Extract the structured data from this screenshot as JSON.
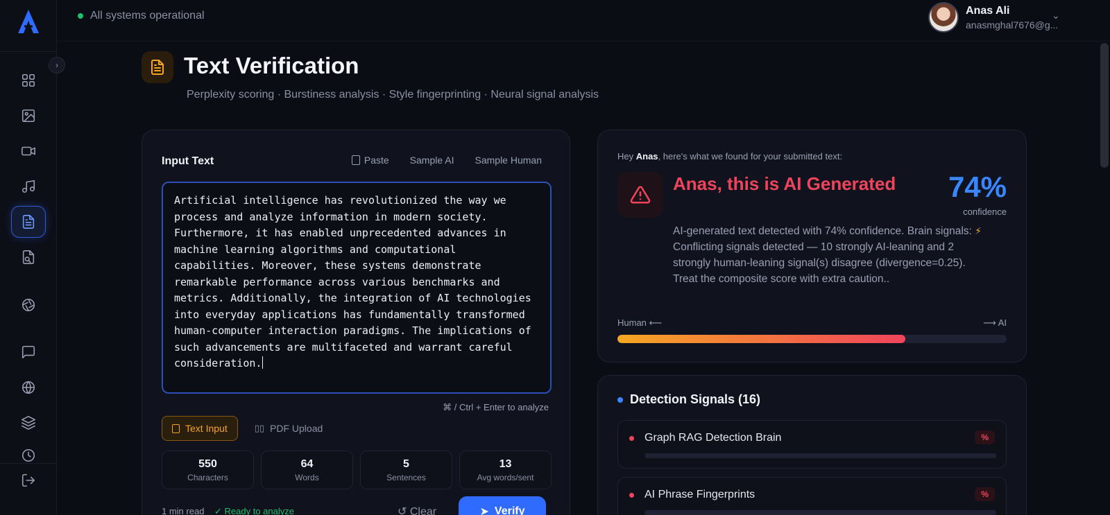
{
  "topbar": {
    "status": "All systems operational"
  },
  "user": {
    "name": "Anas Ali",
    "email": "anasmghal7676@g..."
  },
  "sidebar": {
    "items": [
      {
        "icon": "dashboard-icon"
      },
      {
        "icon": "image-icon"
      },
      {
        "icon": "video-icon"
      },
      {
        "icon": "music-icon"
      },
      {
        "icon": "document-icon",
        "active": true
      },
      {
        "icon": "file-search-icon"
      },
      {
        "icon": "aperture-icon"
      },
      {
        "icon": "chat-icon"
      },
      {
        "icon": "globe-icon"
      },
      {
        "icon": "layers-icon"
      },
      {
        "icon": "history-icon"
      },
      {
        "icon": "logout-icon"
      }
    ]
  },
  "header": {
    "title": "Text Verification",
    "subtitle": "Perplexity scoring · Burstiness analysis · Style fingerprinting · Neural signal analysis"
  },
  "input": {
    "label": "Input Text",
    "actions": {
      "paste": "Paste",
      "sample_ai": "Sample AI",
      "sample_human": "Sample Human"
    },
    "text": "Artificial intelligence has revolutionized the way we process and analyze information in modern society. Furthermore, it has enabled unprecedented advances in machine learning algorithms and computational capabilities. Moreover, these systems demonstrate remarkable performance across various benchmarks and metrics. Additionally, the integration of AI technologies into everyday applications has fundamentally transformed human-computer interaction paradigms. The implications of such advancements are multifaceted and warrant careful consideration.",
    "shortcut": "⌘ / Ctrl + Enter to analyze",
    "modes": {
      "text": "Text Input",
      "pdf": "PDF Upload"
    },
    "stats": [
      {
        "value": "550",
        "label": "Characters"
      },
      {
        "value": "64",
        "label": "Words"
      },
      {
        "value": "5",
        "label": "Sentences"
      },
      {
        "value": "13",
        "label": "Avg words/sent"
      }
    ],
    "read_time": "1 min read",
    "ready": "✓ Ready to analyze",
    "clear": "↺ Clear",
    "verify": "Verify"
  },
  "result": {
    "greet_prefix": "Hey",
    "greet_name": "Anas",
    "greet_suffix": ", here's what we found for your submitted text:",
    "verdict": "Anas, this is AI Generated",
    "confidence_value": "74%",
    "confidence_label": "confidence",
    "desc_part1": "AI-generated text detected with 74% confidence. Brain signals: ",
    "desc_part2": "Conflicting signals detected — 10 strongly AI-leaning and 2 strongly human-leaning signal(s) disagree (divergence=0.25). Treat the composite score with extra caution..",
    "scale_left": "Human ⟵",
    "scale_right": "⟶ AI",
    "score": 0.74,
    "colors": {
      "ai": "#f0445c",
      "accent": "#3a86ff",
      "warn": "#f5a623"
    }
  },
  "signals": {
    "title": "Detection Signals (16)",
    "items": [
      {
        "name": "Graph RAG Detection Brain",
        "badge": "%"
      },
      {
        "name": "AI Phrase Fingerprints",
        "badge": "%"
      }
    ]
  }
}
